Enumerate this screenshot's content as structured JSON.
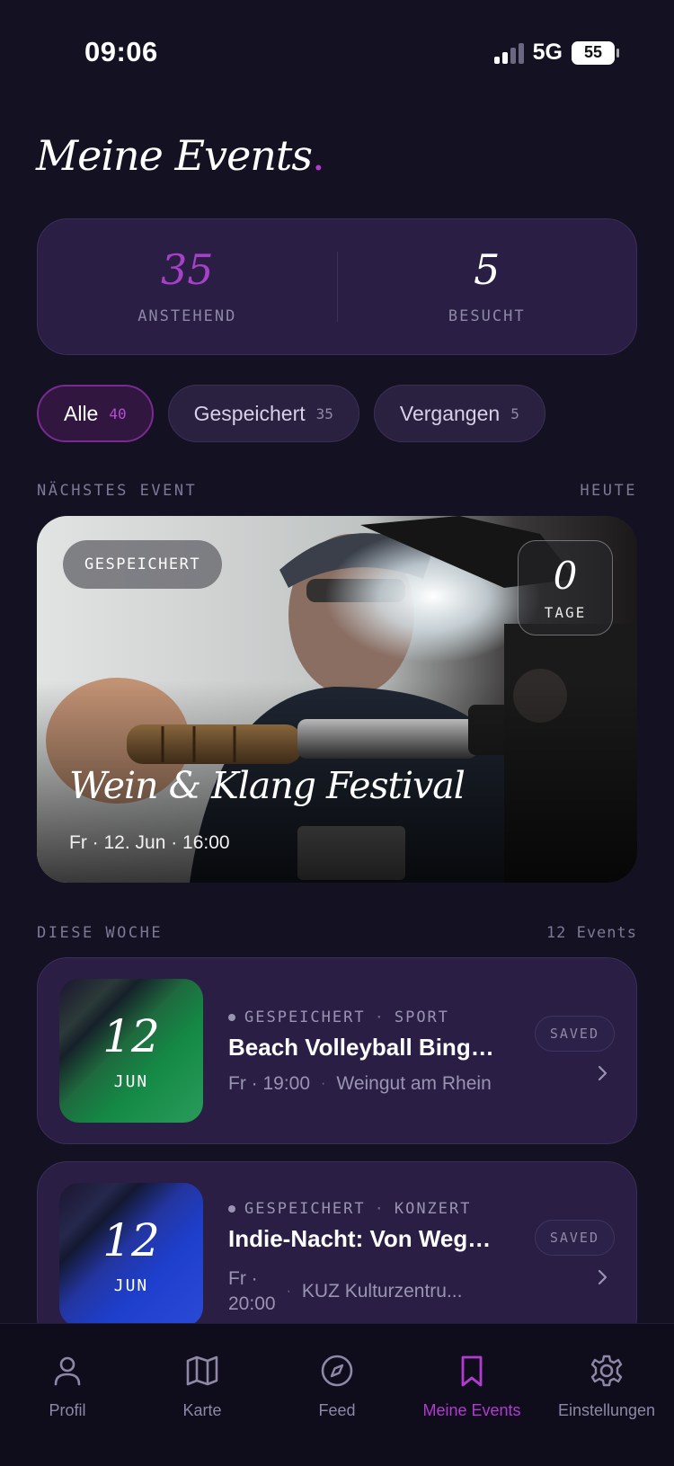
{
  "status_bar": {
    "time": "09:06",
    "network": "5G",
    "battery": "55"
  },
  "header": {
    "title": "Meine Events",
    "title_dot": "."
  },
  "stats": {
    "upcoming": {
      "value": "35",
      "label": "ANSTEHEND"
    },
    "visited": {
      "value": "5",
      "label": "BESUCHT"
    }
  },
  "filters": [
    {
      "label": "Alle",
      "count": "40",
      "active": true
    },
    {
      "label": "Gespeichert",
      "count": "35",
      "active": false
    },
    {
      "label": "Vergangen",
      "count": "5",
      "active": false
    }
  ],
  "next_event": {
    "section_label": "NÄCHSTES EVENT",
    "section_right": "HEUTE",
    "badge": "GESPEICHERT",
    "days_value": "0",
    "days_label": "TAGE",
    "name": "Wein & Klang Festival",
    "when": "Fr · 12. Jun · 16:00"
  },
  "this_week": {
    "section_label": "DIESE WOCHE",
    "section_right": "12 Events",
    "events": [
      {
        "day": "12",
        "month": "JUN",
        "status": "GESPEICHERT",
        "category": "SPORT",
        "name": "Beach Volleyball Bingo Night",
        "time": "Fr · 19:00",
        "venue": "Weingut am Rhein",
        "tag": "SAVED",
        "thumb_color": "#148a46"
      },
      {
        "day": "12",
        "month": "JUN",
        "status": "GESPEICHERT",
        "category": "KONZERT",
        "name": "Indie-Nacht: Von Wegen Lisbeth",
        "time_line1": "Fr ·",
        "time_line2": "20:00",
        "venue": "KUZ Kulturzentru...",
        "tag": "SAVED",
        "thumb_color": "#1e3fcc"
      }
    ]
  },
  "nav": [
    {
      "label": "Profil",
      "icon": "person-icon"
    },
    {
      "label": "Karte",
      "icon": "map-icon"
    },
    {
      "label": "Feed",
      "icon": "compass-icon"
    },
    {
      "label": "Meine Events",
      "icon": "bookmark-icon",
      "active": true
    },
    {
      "label": "Einstellungen",
      "icon": "gear-icon"
    }
  ],
  "colors": {
    "accent": "#B23BD0",
    "background": "#141122",
    "card": "#2A1E45"
  }
}
